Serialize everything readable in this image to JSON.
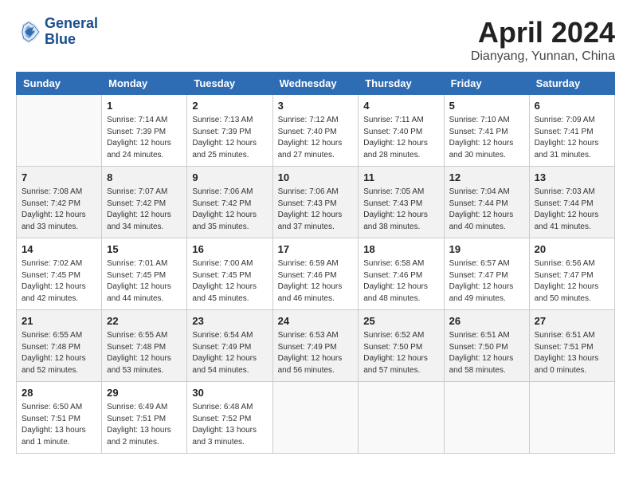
{
  "logo": {
    "text_line1": "General",
    "text_line2": "Blue"
  },
  "title": "April 2024",
  "subtitle": "Dianyang, Yunnan, China",
  "days_of_week": [
    "Sunday",
    "Monday",
    "Tuesday",
    "Wednesday",
    "Thursday",
    "Friday",
    "Saturday"
  ],
  "weeks": [
    [
      {
        "day": "",
        "info": ""
      },
      {
        "day": "1",
        "info": "Sunrise: 7:14 AM\nSunset: 7:39 PM\nDaylight: 12 hours\nand 24 minutes."
      },
      {
        "day": "2",
        "info": "Sunrise: 7:13 AM\nSunset: 7:39 PM\nDaylight: 12 hours\nand 25 minutes."
      },
      {
        "day": "3",
        "info": "Sunrise: 7:12 AM\nSunset: 7:40 PM\nDaylight: 12 hours\nand 27 minutes."
      },
      {
        "day": "4",
        "info": "Sunrise: 7:11 AM\nSunset: 7:40 PM\nDaylight: 12 hours\nand 28 minutes."
      },
      {
        "day": "5",
        "info": "Sunrise: 7:10 AM\nSunset: 7:41 PM\nDaylight: 12 hours\nand 30 minutes."
      },
      {
        "day": "6",
        "info": "Sunrise: 7:09 AM\nSunset: 7:41 PM\nDaylight: 12 hours\nand 31 minutes."
      }
    ],
    [
      {
        "day": "7",
        "info": "Sunrise: 7:08 AM\nSunset: 7:42 PM\nDaylight: 12 hours\nand 33 minutes."
      },
      {
        "day": "8",
        "info": "Sunrise: 7:07 AM\nSunset: 7:42 PM\nDaylight: 12 hours\nand 34 minutes."
      },
      {
        "day": "9",
        "info": "Sunrise: 7:06 AM\nSunset: 7:42 PM\nDaylight: 12 hours\nand 35 minutes."
      },
      {
        "day": "10",
        "info": "Sunrise: 7:06 AM\nSunset: 7:43 PM\nDaylight: 12 hours\nand 37 minutes."
      },
      {
        "day": "11",
        "info": "Sunrise: 7:05 AM\nSunset: 7:43 PM\nDaylight: 12 hours\nand 38 minutes."
      },
      {
        "day": "12",
        "info": "Sunrise: 7:04 AM\nSunset: 7:44 PM\nDaylight: 12 hours\nand 40 minutes."
      },
      {
        "day": "13",
        "info": "Sunrise: 7:03 AM\nSunset: 7:44 PM\nDaylight: 12 hours\nand 41 minutes."
      }
    ],
    [
      {
        "day": "14",
        "info": "Sunrise: 7:02 AM\nSunset: 7:45 PM\nDaylight: 12 hours\nand 42 minutes."
      },
      {
        "day": "15",
        "info": "Sunrise: 7:01 AM\nSunset: 7:45 PM\nDaylight: 12 hours\nand 44 minutes."
      },
      {
        "day": "16",
        "info": "Sunrise: 7:00 AM\nSunset: 7:45 PM\nDaylight: 12 hours\nand 45 minutes."
      },
      {
        "day": "17",
        "info": "Sunrise: 6:59 AM\nSunset: 7:46 PM\nDaylight: 12 hours\nand 46 minutes."
      },
      {
        "day": "18",
        "info": "Sunrise: 6:58 AM\nSunset: 7:46 PM\nDaylight: 12 hours\nand 48 minutes."
      },
      {
        "day": "19",
        "info": "Sunrise: 6:57 AM\nSunset: 7:47 PM\nDaylight: 12 hours\nand 49 minutes."
      },
      {
        "day": "20",
        "info": "Sunrise: 6:56 AM\nSunset: 7:47 PM\nDaylight: 12 hours\nand 50 minutes."
      }
    ],
    [
      {
        "day": "21",
        "info": "Sunrise: 6:55 AM\nSunset: 7:48 PM\nDaylight: 12 hours\nand 52 minutes."
      },
      {
        "day": "22",
        "info": "Sunrise: 6:55 AM\nSunset: 7:48 PM\nDaylight: 12 hours\nand 53 minutes."
      },
      {
        "day": "23",
        "info": "Sunrise: 6:54 AM\nSunset: 7:49 PM\nDaylight: 12 hours\nand 54 minutes."
      },
      {
        "day": "24",
        "info": "Sunrise: 6:53 AM\nSunset: 7:49 PM\nDaylight: 12 hours\nand 56 minutes."
      },
      {
        "day": "25",
        "info": "Sunrise: 6:52 AM\nSunset: 7:50 PM\nDaylight: 12 hours\nand 57 minutes."
      },
      {
        "day": "26",
        "info": "Sunrise: 6:51 AM\nSunset: 7:50 PM\nDaylight: 12 hours\nand 58 minutes."
      },
      {
        "day": "27",
        "info": "Sunrise: 6:51 AM\nSunset: 7:51 PM\nDaylight: 13 hours\nand 0 minutes."
      }
    ],
    [
      {
        "day": "28",
        "info": "Sunrise: 6:50 AM\nSunset: 7:51 PM\nDaylight: 13 hours\nand 1 minute."
      },
      {
        "day": "29",
        "info": "Sunrise: 6:49 AM\nSunset: 7:51 PM\nDaylight: 13 hours\nand 2 minutes."
      },
      {
        "day": "30",
        "info": "Sunrise: 6:48 AM\nSunset: 7:52 PM\nDaylight: 13 hours\nand 3 minutes."
      },
      {
        "day": "",
        "info": ""
      },
      {
        "day": "",
        "info": ""
      },
      {
        "day": "",
        "info": ""
      },
      {
        "day": "",
        "info": ""
      }
    ]
  ]
}
